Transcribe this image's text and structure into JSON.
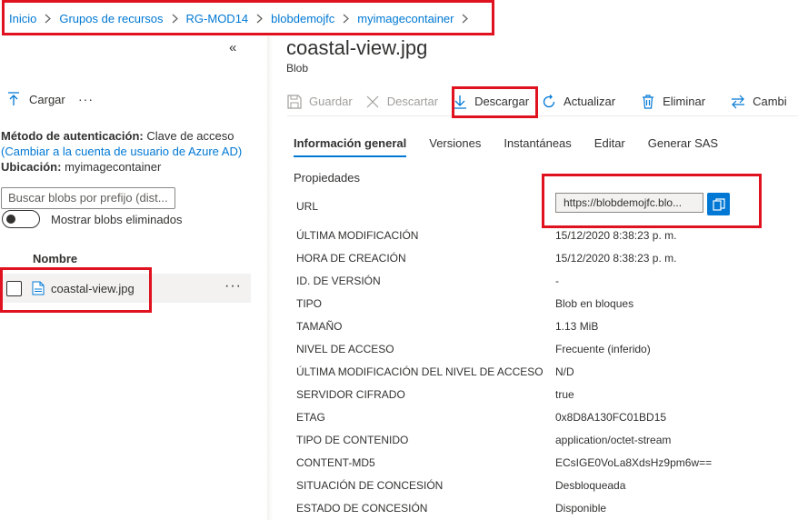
{
  "breadcrumb": [
    "Inicio",
    "Grupos de recursos",
    "RG-MOD14",
    "blobdemojfc",
    "myimagecontainer"
  ],
  "left": {
    "collapse_glyph": "«",
    "upload_label": "Cargar",
    "more_glyph": "···",
    "auth_method_label": "Método de autenticación:",
    "auth_method_value": "Clave de acceso",
    "switch_link": "(Cambiar a la cuenta de usuario de Azure AD)",
    "location_label": "Ubicación:",
    "location_value": "myimagecontainer",
    "search_placeholder": "Buscar blobs por prefijo (dist...",
    "show_deleted_label": "Mostrar blobs eliminados",
    "column_name": "Nombre",
    "file_name": "coastal-view.jpg",
    "row_more": "···"
  },
  "blob": {
    "title": "coastal-view.jpg",
    "subtitle": "Blob"
  },
  "toolbar": {
    "save": "Guardar",
    "discard": "Descartar",
    "download": "Descargar",
    "refresh": "Actualizar",
    "delete": "Eliminar",
    "change": "Cambi"
  },
  "tabs": [
    "Información general",
    "Versiones",
    "Instantáneas",
    "Editar",
    "Generar SAS"
  ],
  "properties": {
    "heading": "Propiedades",
    "url_label": "URL",
    "url_value": "https://blobdemojfc.blo...",
    "rows": [
      {
        "label": "ÚLTIMA MODIFICACIÓN",
        "value": "15/12/2020 8:38:23 p. m."
      },
      {
        "label": "HORA DE CREACIÓN",
        "value": "15/12/2020 8:38:23 p. m."
      },
      {
        "label": "ID. DE VERSIÓN",
        "value": "-"
      },
      {
        "label": "TIPO",
        "value": "Blob en bloques"
      },
      {
        "label": "TAMAÑO",
        "value": "1.13 MiB"
      },
      {
        "label": "NIVEL DE ACCESO",
        "value": "Frecuente (inferido)"
      },
      {
        "label": "ÚLTIMA MODIFICACIÓN DEL NIVEL DE ACCESO",
        "value": "N/D"
      },
      {
        "label": "SERVIDOR CIFRADO",
        "value": "true"
      },
      {
        "label": "ETAG",
        "value": "0x8D8A130FC01BD15"
      },
      {
        "label": "TIPO DE CONTENIDO",
        "value": "application/octet-stream"
      },
      {
        "label": "CONTENT-MD5",
        "value": "ECsIGE0VoLa8XdsHz9pm6w=="
      },
      {
        "label": "SITUACIÓN DE CONCESIÓN",
        "value": "Desbloqueada"
      },
      {
        "label": "ESTADO DE CONCESIÓN",
        "value": "Disponible"
      }
    ]
  },
  "colors": {
    "accent": "#0078d4",
    "highlight_box": "#e0121f",
    "text": "#323130",
    "disabled": "#a19f9d"
  },
  "icons": [
    "chevron-right-icon",
    "upload-arrow-icon",
    "file-icon",
    "save-icon",
    "discard-x-icon",
    "download-icon",
    "refresh-icon",
    "trash-icon",
    "swap-icon",
    "copy-icon"
  ]
}
